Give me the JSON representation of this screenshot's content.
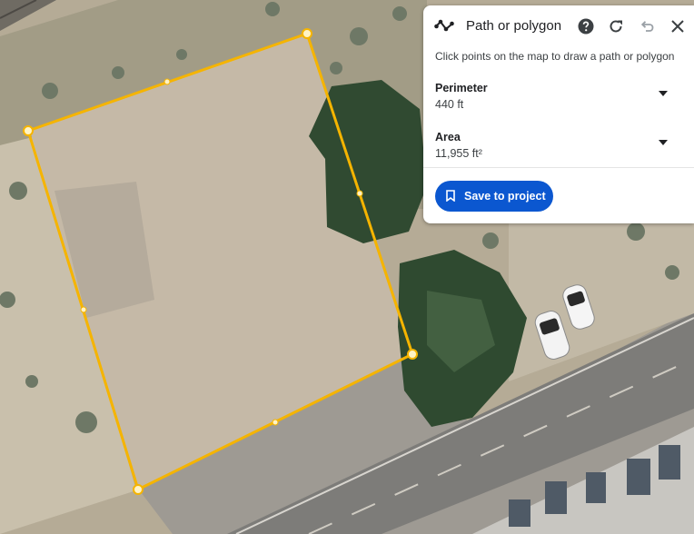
{
  "panel": {
    "title": "Path or polygon",
    "hint": "Click points on the map to draw a path or polygon",
    "perimeter": {
      "label": "Perimeter",
      "value": "440 ft"
    },
    "area": {
      "label": "Area",
      "value": "11,955 ft²"
    },
    "save_label": "Save to project"
  },
  "icons": {
    "path": "path-or-polygon-icon",
    "help": "help-icon",
    "reset": "reset-icon",
    "undo": "undo-icon",
    "close": "close-icon",
    "expand": "chevron-down-icon",
    "bookmark": "bookmark-icon"
  },
  "colors": {
    "polygon_outline": "#f5b400",
    "vertex": "#fff3c4",
    "panel_bg": "#ffffff",
    "save_button": "#0b57d0",
    "trees": "#2f4a30"
  }
}
